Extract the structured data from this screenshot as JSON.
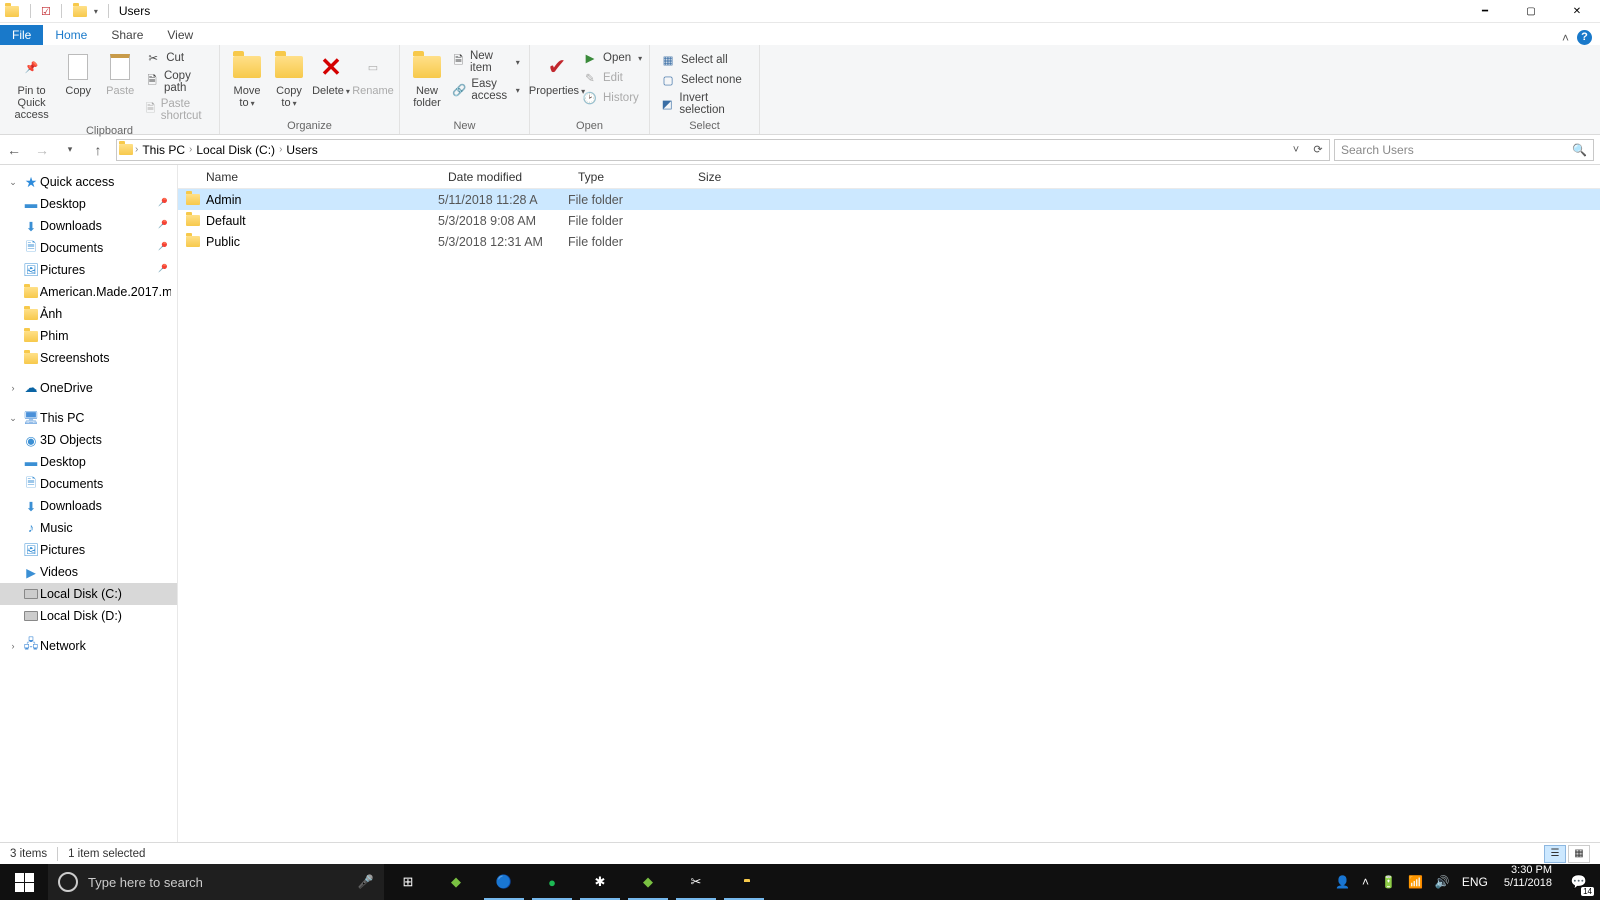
{
  "window": {
    "title": "Users"
  },
  "ribbon": {
    "tabs": {
      "file": "File",
      "home": "Home",
      "share": "Share",
      "view": "View"
    },
    "clipboard": {
      "label": "Clipboard",
      "pin": "Pin to Quick access",
      "copy": "Copy",
      "paste": "Paste",
      "cut": "Cut",
      "copypath": "Copy path",
      "pasteshortcut": "Paste shortcut"
    },
    "organize": {
      "label": "Organize",
      "moveto": "Move to",
      "copyto": "Copy to",
      "delete": "Delete",
      "rename": "Rename"
    },
    "new": {
      "label": "New",
      "newfolder": "New folder",
      "newitem": "New item",
      "easyaccess": "Easy access"
    },
    "open": {
      "label": "Open",
      "properties": "Properties",
      "open": "Open",
      "edit": "Edit",
      "history": "History"
    },
    "select": {
      "label": "Select",
      "selectall": "Select all",
      "selectnone": "Select none",
      "invert": "Invert selection"
    }
  },
  "breadcrumb": {
    "thispc": "This PC",
    "disk": "Local Disk (C:)",
    "folder": "Users"
  },
  "search": {
    "placeholder": "Search Users"
  },
  "columns": {
    "name": "Name",
    "date": "Date modified",
    "type": "Type",
    "size": "Size"
  },
  "files": [
    {
      "name": "Admin",
      "date": "5/11/2018 11:28 A",
      "type": "File folder",
      "selected": true
    },
    {
      "name": "Default",
      "date": "5/3/2018 9:08 AM",
      "type": "File folder",
      "selected": false
    },
    {
      "name": "Public",
      "date": "5/3/2018 12:31 AM",
      "type": "File folder",
      "selected": false
    }
  ],
  "nav": {
    "quickaccess": "Quick access",
    "qa": {
      "desktop": "Desktop",
      "downloads": "Downloads",
      "documents": "Documents",
      "pictures": "Pictures",
      "american": "American.Made.2017.m",
      "anh": "Ảnh",
      "phim": "Phim",
      "screenshots": "Screenshots"
    },
    "onedrive": "OneDrive",
    "thispc": "This PC",
    "pc": {
      "objects3d": "3D Objects",
      "desktop": "Desktop",
      "documents": "Documents",
      "downloads": "Downloads",
      "music": "Music",
      "pictures": "Pictures",
      "videos": "Videos",
      "diskc": "Local Disk (C:)",
      "diskd": "Local Disk (D:)"
    },
    "network": "Network"
  },
  "status": {
    "count": "3 items",
    "selected": "1 item selected"
  },
  "taskbar": {
    "search": "Type here to search",
    "lang": "ENG",
    "time": "3:30 PM",
    "date": "5/11/2018",
    "notif": "14"
  }
}
